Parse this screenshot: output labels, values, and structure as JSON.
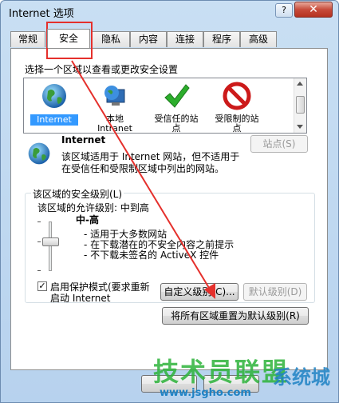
{
  "window": {
    "title": "Internet 选项",
    "help": "?",
    "close": "✕"
  },
  "tabs": [
    {
      "label": "常规"
    },
    {
      "label": "安全"
    },
    {
      "label": "隐私"
    },
    {
      "label": "内容"
    },
    {
      "label": "连接"
    },
    {
      "label": "程序"
    },
    {
      "label": "高级"
    }
  ],
  "zones": {
    "prompt": "选择一个区域以查看或更改安全设置",
    "items": [
      {
        "label": "Internet",
        "icon": "globe-icon"
      },
      {
        "label": "本地\nIntranet",
        "icon": "intranet-globe-icon"
      },
      {
        "label": "受信任的站\n点",
        "icon": "green-check-icon"
      },
      {
        "label": "受限制的站\n点",
        "icon": "restricted-icon"
      }
    ]
  },
  "zone_detail": {
    "name": "Internet",
    "desc_line1": "该区域适用于 Internet 网站，但不适用于",
    "desc_line2": "在受信任和受限制区域中列出的网站。",
    "sites_button": "站点(S)"
  },
  "security_level": {
    "group_title": "该区域的安全级别(L)",
    "allowed": "该区域的允许级别: 中到高",
    "level_name": "中-高",
    "bullets": [
      "- 适用于大多数网站",
      "- 在下载潜在的不安全内容之前提示",
      "- 不下载未签名的 ActiveX 控件"
    ],
    "protected_mode_line1": "启用保护模式(要求重新",
    "protected_mode_line2": "启动 Internet",
    "protected_mode_checked": true,
    "custom_button": "自定义级别(C)...",
    "default_button": "默认级别(D)"
  },
  "reset_button": "将所有区域重置为默认级别(R)",
  "watermark": {
    "main": "技术员联盟",
    "url": "www.jsgho.com",
    "side": "系统城"
  },
  "colors": {
    "annotation_red": "#e5302c",
    "selection_blue": "#3399ff"
  }
}
